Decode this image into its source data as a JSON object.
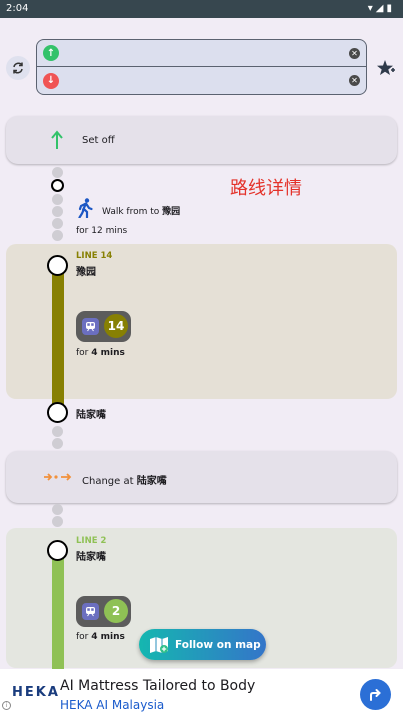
{
  "status_bar": {
    "time": "2:04",
    "icons": [
      "wifi-icon",
      "signal-icon",
      "battery-icon"
    ]
  },
  "search": {
    "start_value": "",
    "end_value": "",
    "start_icon": "arrow-up-icon",
    "end_icon": "arrow-down-icon"
  },
  "page_title": "路线详情",
  "set_off": {
    "label": "Set off"
  },
  "walk": {
    "from_text": "Walk from  to",
    "to_station": "豫园",
    "duration_prefix": "for",
    "duration": "12 mins"
  },
  "segments": [
    {
      "line": "LINE 14",
      "line_number": "14",
      "color": "#878003",
      "station": "豫园",
      "duration_prefix": "for",
      "duration": "4 mins",
      "end_station": "陆家嘴"
    },
    {
      "line": "LINE 2",
      "line_number": "2",
      "color": "#8fc155",
      "station": "陆家嘴",
      "duration_prefix": "for",
      "duration": "4 mins"
    }
  ],
  "change": {
    "prefix": "Change at",
    "station": "陆家嘴"
  },
  "fab": {
    "label": "Follow on map"
  },
  "ad": {
    "brand": "HEKA",
    "headline": "AI Mattress Tailored to Body",
    "subline": "HEKA AI Malaysia"
  },
  "colors": {
    "accent_red": "#e4322a",
    "start_green": "#33c26a",
    "end_red": "#f05454",
    "line14": "#878003",
    "line2": "#8fc155"
  }
}
